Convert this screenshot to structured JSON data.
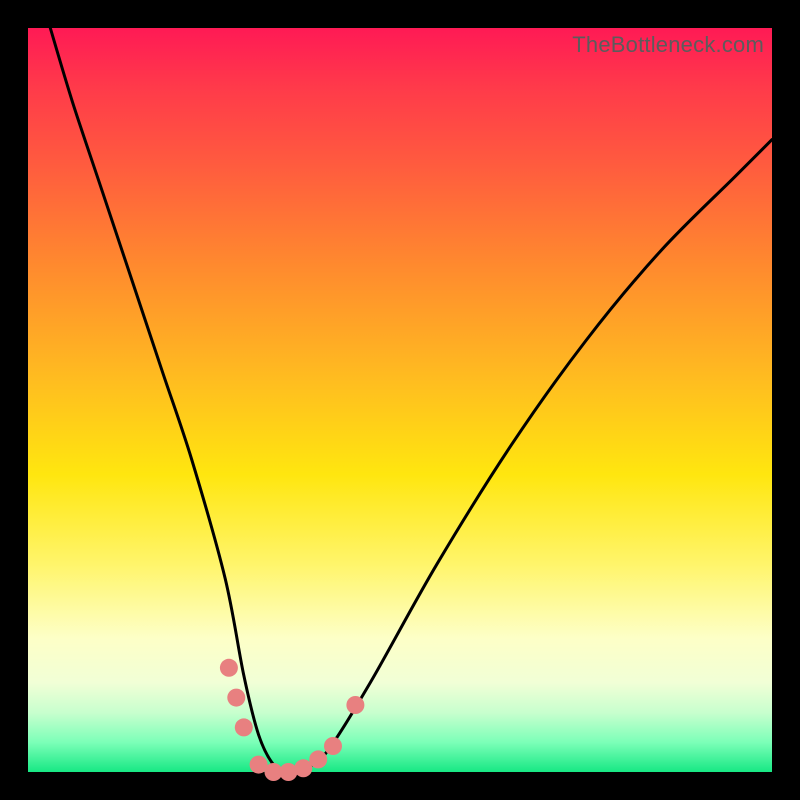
{
  "watermark": "TheBottleneck.com",
  "chart_data": {
    "type": "line",
    "title": "",
    "xlabel": "",
    "ylabel": "",
    "xlim": [
      0,
      100
    ],
    "ylim": [
      0,
      100
    ],
    "series": [
      {
        "name": "bottleneck-curve",
        "x": [
          3,
          6,
          10,
          14,
          18,
          22,
          26.5,
          29,
          31,
          33,
          35,
          37,
          40,
          46,
          55,
          65,
          75,
          85,
          95,
          100
        ],
        "values": [
          100,
          90,
          78,
          66,
          54,
          42,
          26,
          13,
          5,
          1,
          0,
          0.5,
          2.5,
          12,
          28,
          44,
          58,
          70,
          80,
          85
        ]
      }
    ],
    "markers": [
      {
        "x": 27,
        "y": 14
      },
      {
        "x": 28,
        "y": 10
      },
      {
        "x": 29,
        "y": 6
      },
      {
        "x": 31,
        "y": 1
      },
      {
        "x": 33,
        "y": 0
      },
      {
        "x": 35,
        "y": 0
      },
      {
        "x": 37,
        "y": 0.5
      },
      {
        "x": 39,
        "y": 1.7
      },
      {
        "x": 41,
        "y": 3.5
      },
      {
        "x": 44,
        "y": 9
      }
    ],
    "gradient_stops": [
      {
        "pos": 0,
        "color": "#ff1a55"
      },
      {
        "pos": 18,
        "color": "#ff5a3f"
      },
      {
        "pos": 48,
        "color": "#ffbf1f"
      },
      {
        "pos": 72,
        "color": "#fff56a"
      },
      {
        "pos": 88,
        "color": "#f1ffd6"
      },
      {
        "pos": 100,
        "color": "#17e884"
      }
    ],
    "curve_color": "#000000",
    "marker_color": "#e88080"
  }
}
